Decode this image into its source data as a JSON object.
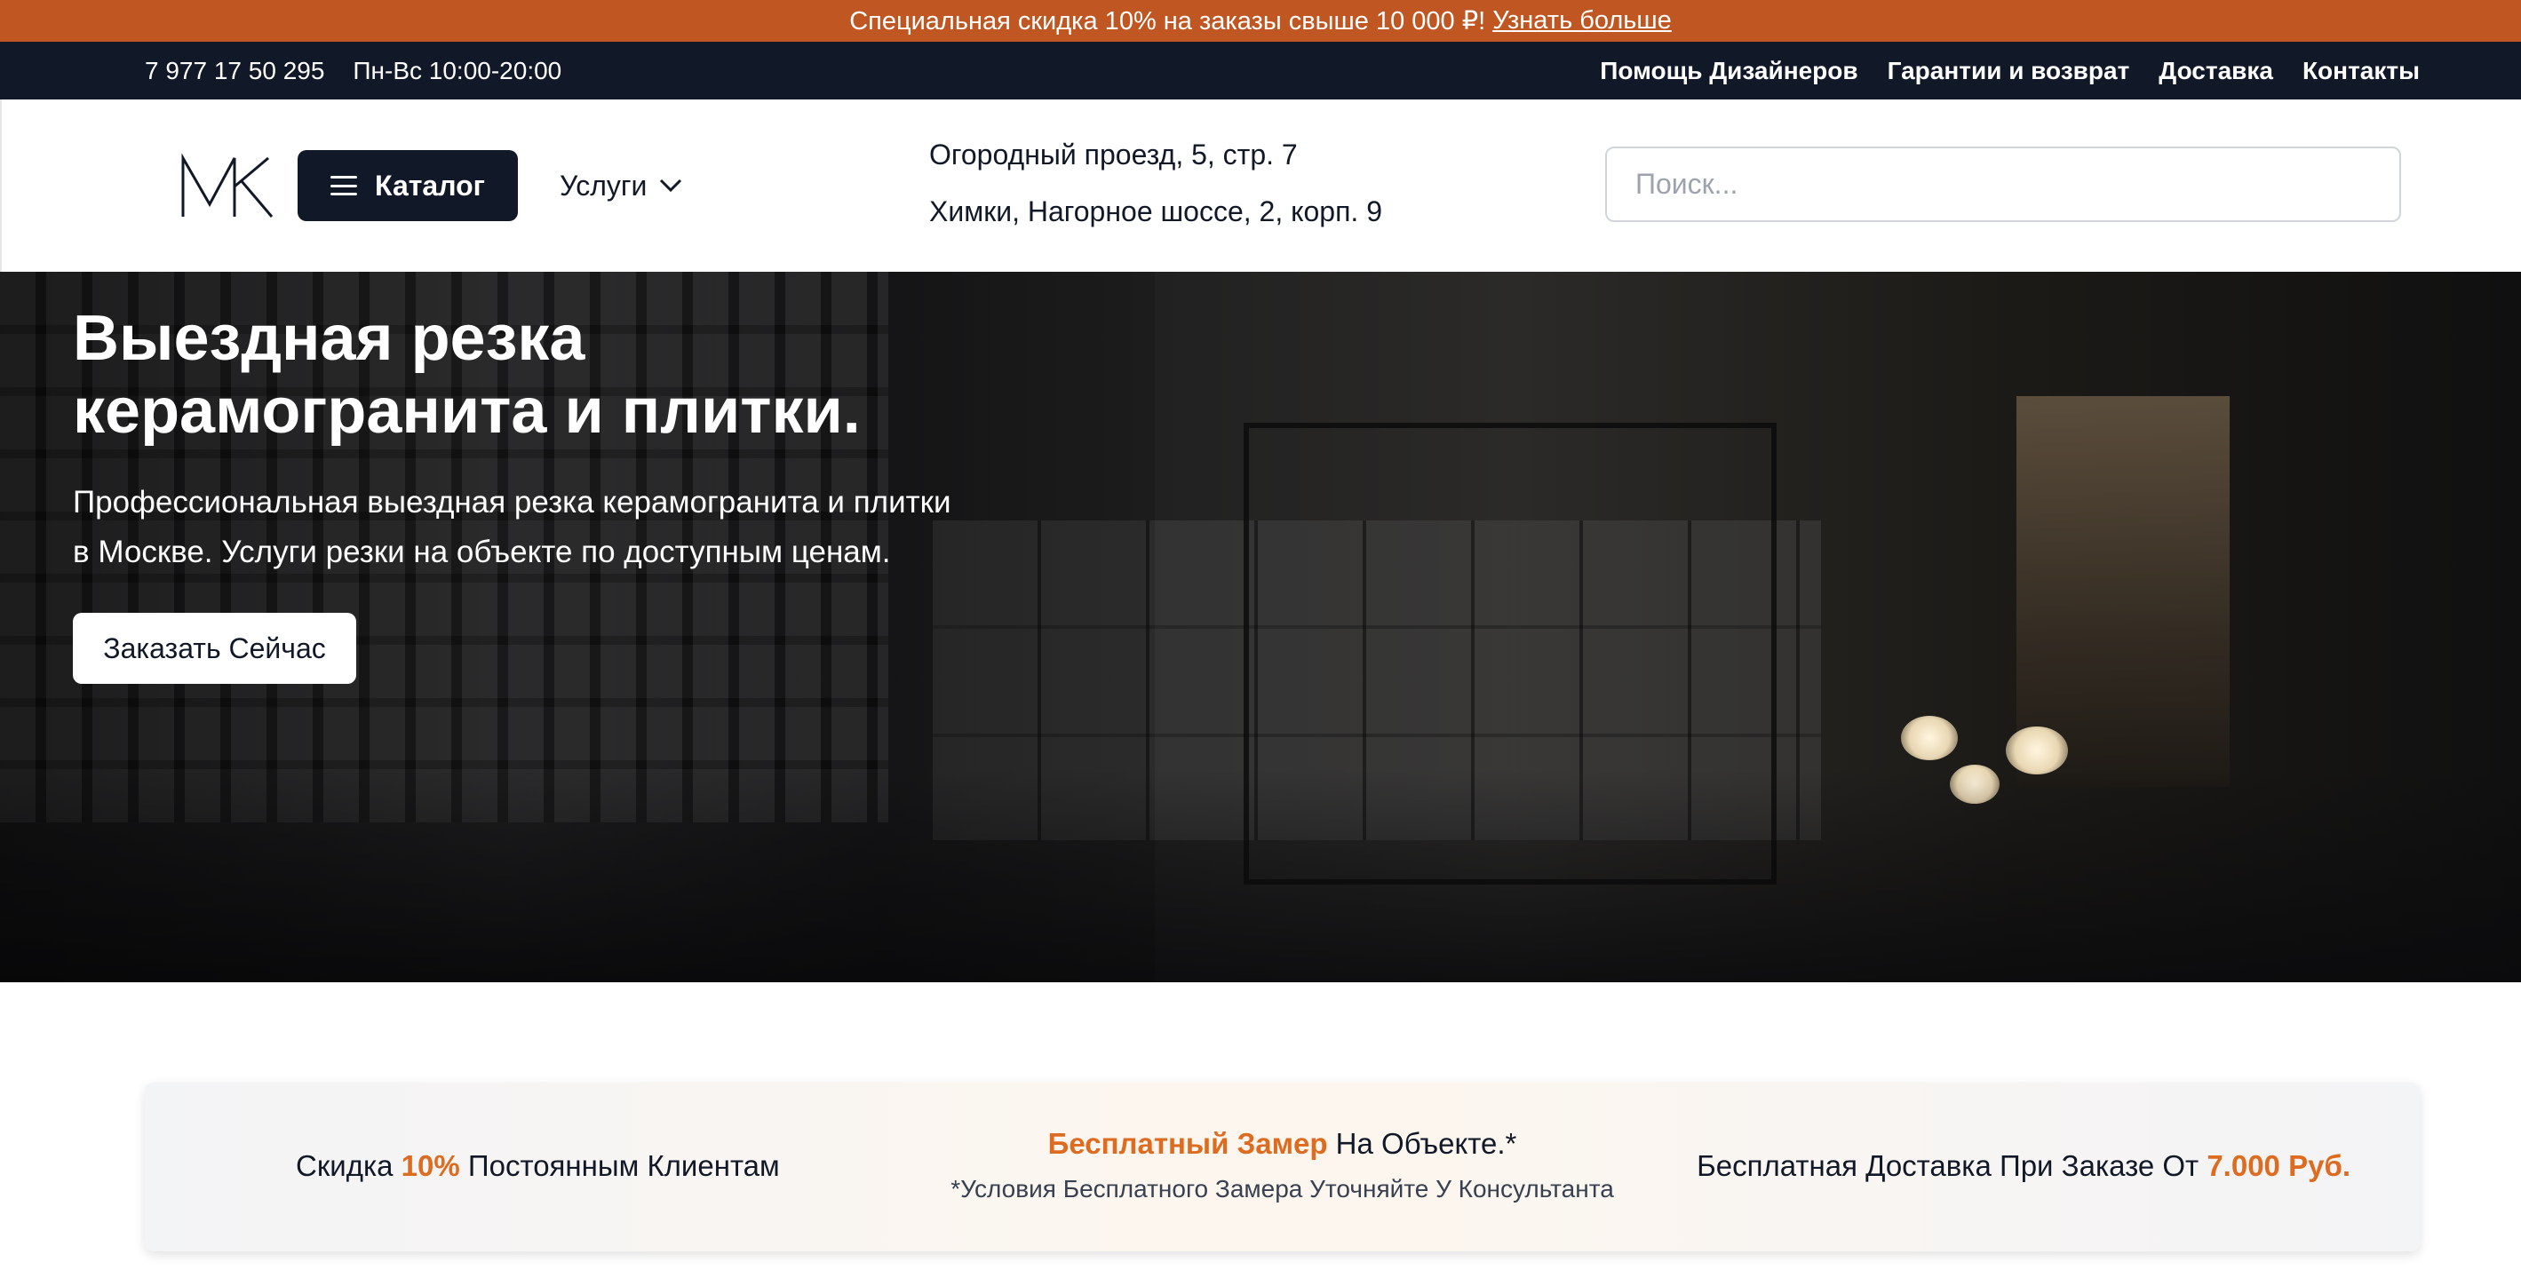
{
  "promo": {
    "text": "Специальная скидка 10% на заказы свыше 10 000 ₽!",
    "link": "Узнать больше"
  },
  "topbar": {
    "phone": "7 977 17 50 295",
    "hours": "Пн-Вс 10:00-20:00",
    "links": [
      "Помощь Дизайнеров",
      "Гарантии и возврат",
      "Доставка",
      "Контакты"
    ]
  },
  "header": {
    "catalog_label": "Каталог",
    "services_label": "Услуги",
    "address_1": "Огородный проезд, 5, стр. 7",
    "address_2": "Химки, Нагорное шоссе, 2, корп. 9",
    "search_placeholder": "Поиск..."
  },
  "hero": {
    "title_line1": "Выездная резка",
    "title_line2": "керамогранита и плитки.",
    "subtitle_line1": "Профессиональная выездная резка керамогранита и плитки",
    "subtitle_line2": "в Москве. Услуги резки на объекте по доступным ценам.",
    "cta_label": "Заказать Сейчас"
  },
  "benefits": {
    "b1_prefix": "Скидка ",
    "b1_accent": "10%",
    "b1_suffix": " Постоянным Клиентам",
    "b2_accent": "Бесплатный Замер",
    "b2_suffix": " На Объекте.*",
    "b2_note": "*Условия Бесплатного Замера Уточняйте У Консультанта",
    "b3_prefix": "Бесплатная Доставка При Заказе От ",
    "b3_accent": "7.000 Руб."
  },
  "colors": {
    "promo_bg": "#c05621",
    "topbar_bg": "#111827",
    "accent": "#dd6b20"
  }
}
